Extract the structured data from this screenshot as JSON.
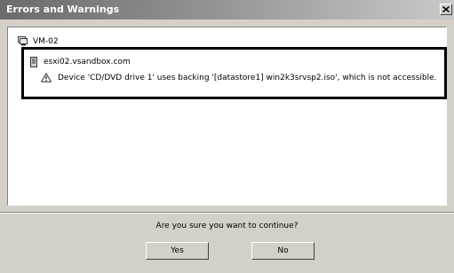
{
  "window": {
    "title": "Errors and Warnings",
    "close_icon": "close-icon"
  },
  "tree": {
    "vm": {
      "label": "VM-02",
      "icon": "virtual-machine-icon"
    },
    "host": {
      "label": "esxi02.vsandbox.com",
      "icon": "host-server-icon"
    },
    "warning": {
      "icon": "warning-triangle-icon",
      "message": "Device 'CD/DVD drive 1' uses backing '[datastore1] win2k3srvsp2.iso', which is not accessible."
    }
  },
  "prompt": {
    "question": "Are you sure you want to continue?",
    "yes_label": "Yes",
    "no_label": "No"
  }
}
